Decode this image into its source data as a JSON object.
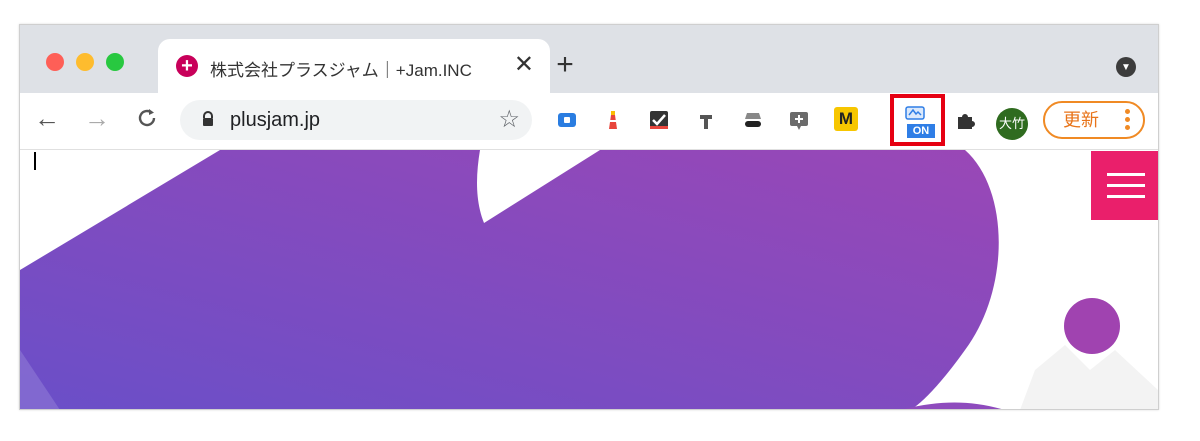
{
  "tab": {
    "title": "株式会社プラスジャム｜+Jam.INC",
    "favicon": "+",
    "close": "✕"
  },
  "newtab": "+",
  "omnibox": {
    "url": "plusjam.jp",
    "star": "☆"
  },
  "nav": {
    "back": "←",
    "forward": "→",
    "reload": "C"
  },
  "extensions": {
    "m_label": "M",
    "on_label": "ON",
    "highlighted": "on-off-extension-icon"
  },
  "profile": {
    "avatar": "大竹"
  },
  "update": {
    "label": "更新"
  },
  "colors": {
    "accent_orange": "#f08a24",
    "highlight_red": "#e60012",
    "hamburger_pink": "#ea1f6b",
    "hero_purple_start": "#6a4fc8",
    "hero_purple_end": "#9a47b6"
  }
}
